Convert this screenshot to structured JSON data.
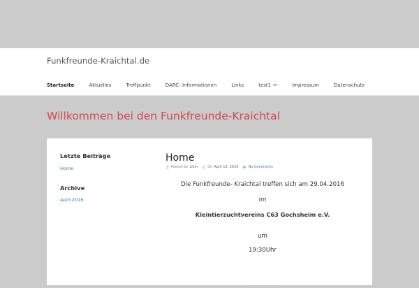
{
  "site": {
    "title": "Funkfreunde-Kraichtal.de"
  },
  "nav": {
    "items": [
      {
        "label": "Startseite",
        "active": true
      },
      {
        "label": "Aktuelles"
      },
      {
        "label": "Treffpunkt"
      },
      {
        "label": "DARC- Informationen"
      },
      {
        "label": "Links"
      },
      {
        "label": "test1",
        "has_dropdown": true
      },
      {
        "label": "Impressum"
      },
      {
        "label": "Datenschutz"
      }
    ]
  },
  "welcome": "Willkommen bei den Funkfreunde-Kraichtal",
  "sidebar": {
    "recent_title": "Letzte Beiträge",
    "recent_items": [
      "Home"
    ],
    "archive_title": "Archive",
    "archive_items": [
      "April 2016"
    ]
  },
  "post": {
    "title": "Home",
    "meta": {
      "posted_by_label": "Posted by",
      "author": "Likin",
      "on_label": "On",
      "date": "April 13, 2016",
      "comments": "No Comments"
    },
    "lines": [
      "Die Funkfreunde- Kraichtal treffen sich am 29.04.2016",
      "im",
      "Kleintierzuchtvereins C63 Gochsheim e.V.",
      "um",
      "19:30Uhr"
    ]
  },
  "colors": {
    "background": "#cbcbcb",
    "accent_red": "#d24a4f",
    "link_blue": "#3a7bb6"
  }
}
